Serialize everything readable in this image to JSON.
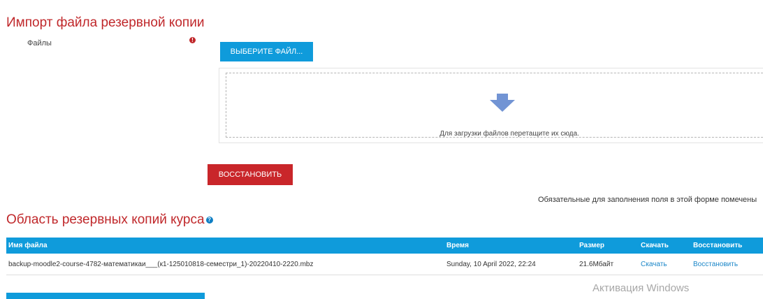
{
  "import_section": {
    "heading": "Импорт файла резервной копии",
    "files_label": "Файлы",
    "required_mark": "!",
    "choose_file_button": "ВЫБЕРИТЕ ФАЙЛ...",
    "drop_text": "Для загрузки файлов перетащите их сюда.",
    "restore_button": "ВОССТАНОВИТЬ",
    "required_note": "Обязательные для заполнения поля в этой форме помечены"
  },
  "backup_section": {
    "heading": "Область резервных копий курса",
    "help_mark": "?",
    "columns": [
      "Имя файла",
      "Время",
      "Размер",
      "Скачать",
      "Восстановить"
    ],
    "rows": [
      {
        "filename": "backup-moodle2-course-4782-математикаи___(к1-125010818-семестри_1)-20220410-2220.mbz",
        "time": "Sunday, 10 April 2022, 22:24",
        "size": "21.6Мбайт",
        "download": "Скачать",
        "restore": "Восстановить"
      }
    ]
  },
  "watermark": "Активация Windows",
  "colors": {
    "heading": "#c0282b",
    "primary": "#0f9bdb",
    "danger": "#c9262a",
    "link": "#1a86c8"
  },
  "icons": {
    "required": "exclamation-circle-icon",
    "help": "question-circle-icon",
    "drop": "down-arrow-icon"
  }
}
